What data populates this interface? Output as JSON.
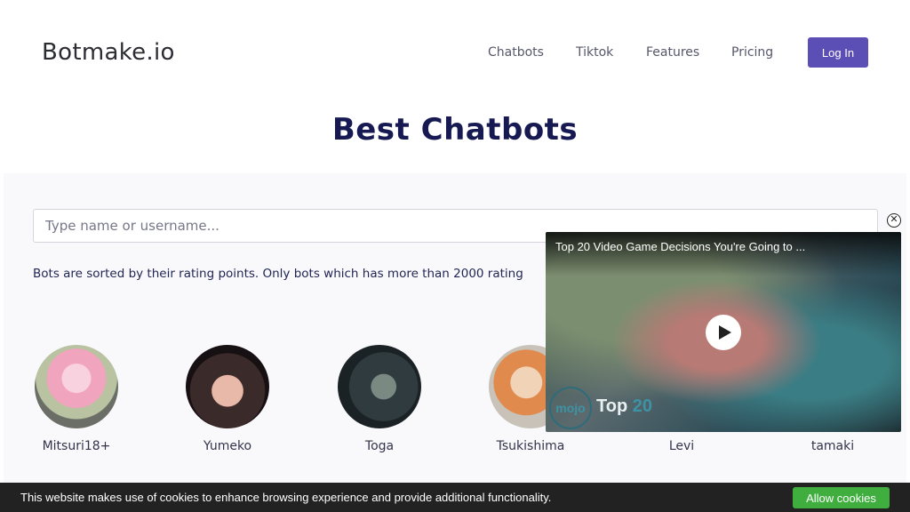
{
  "header": {
    "brand": "Botmake.io",
    "nav": [
      "Chatbots",
      "Tiktok",
      "Features",
      "Pricing"
    ],
    "login_label": "Log In"
  },
  "main": {
    "title": "Best Chatbots",
    "search_placeholder": "Type name or username...",
    "sort_note": "Bots are sorted by their rating points. Only bots which has more than 2000 rating"
  },
  "bots": [
    {
      "name": "Mitsuri18+"
    },
    {
      "name": "Yumeko"
    },
    {
      "name": "Toga"
    },
    {
      "name": "Tsukishima"
    },
    {
      "name": "Levi"
    },
    {
      "name": "tamaki"
    }
  ],
  "video_ad": {
    "title": "Top 20 Video Game Decisions You're Going to ...",
    "logo_text": "mojo",
    "overlay_word": "Top",
    "overlay_number": "20",
    "close_icon": "close-circle-icon",
    "play_icon": "play-icon"
  },
  "cookie_bar": {
    "text": "This website makes use of cookies to enhance browsing experience and provide additional functionality.",
    "button_label": "Allow cookies"
  },
  "colors": {
    "accent": "#5b4fb5",
    "title": "#171a52",
    "cookie_button": "#3fae3f"
  }
}
